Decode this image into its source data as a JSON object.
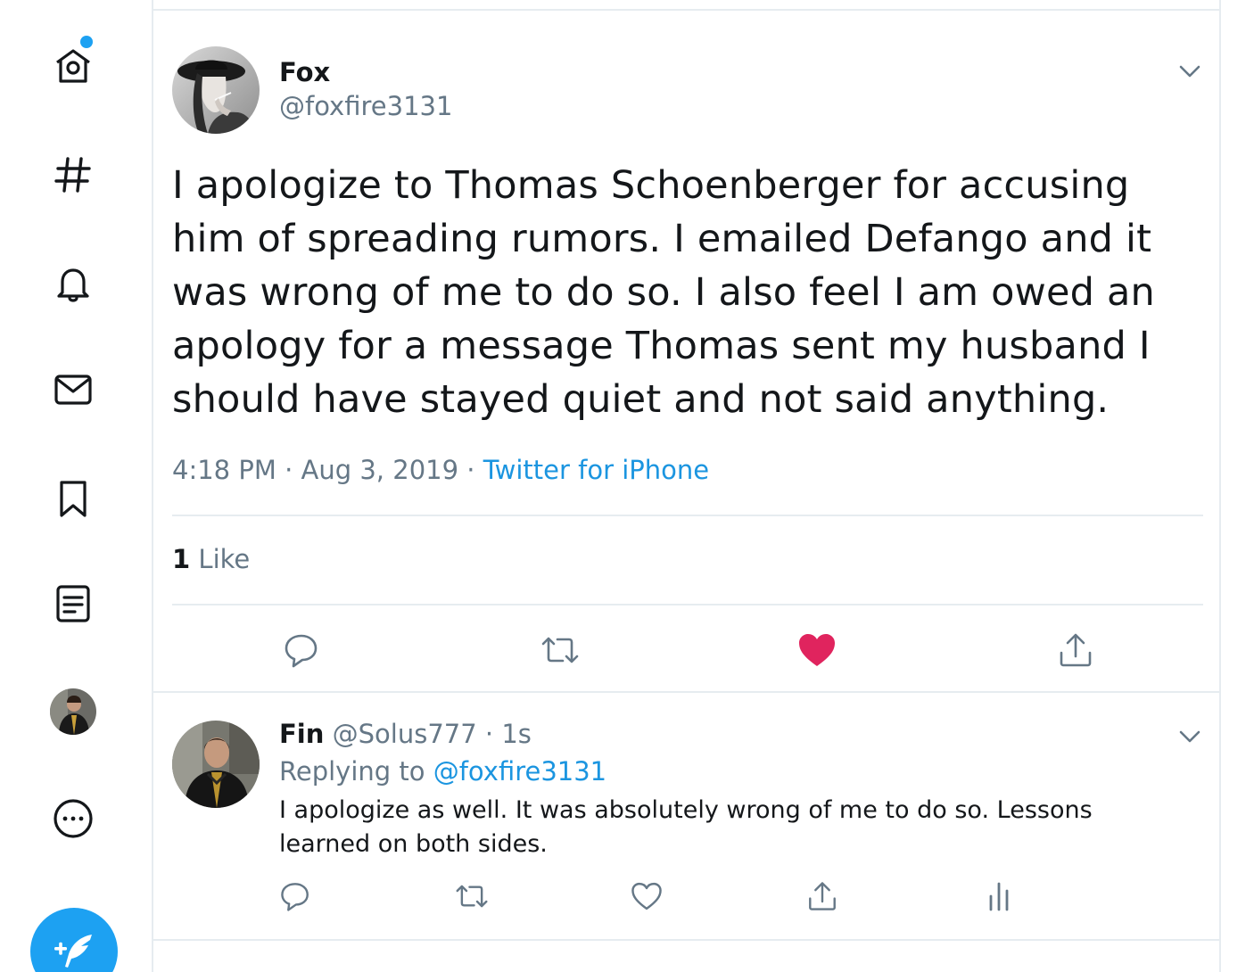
{
  "sidebar": {
    "icons": [
      "home-icon",
      "explore-hashtag-icon",
      "notifications-bell-icon",
      "messages-envelope-icon",
      "bookmarks-icon",
      "lists-icon",
      "more-icon",
      "compose-tweet-icon"
    ],
    "accent": "#1da1f2"
  },
  "tweet": {
    "display_name": "Fox",
    "handle": "@foxfire3131",
    "text": "I apologize to Thomas Schoenberger for accusing him of spreading rumors. I emailed Defango and it was wrong of me to do so. I also feel I am owed an apology for a message Thomas sent my husband I should have stayed quiet and not said anything.",
    "time": "4:18 PM",
    "date": "Aug 3, 2019",
    "separator": "·",
    "source": "Twitter for iPhone",
    "like_count": "1",
    "like_label": "Like",
    "liked": true,
    "like_color": "#e0245e"
  },
  "reply": {
    "display_name": "Fin",
    "handle": "@Solus777",
    "separator": "·",
    "time_ago": "1s",
    "replying_label": "Replying to",
    "replying_to": "@foxfire3131",
    "text": "I apologize as well. It was absolutely wrong of me to do so. Lessons learned on both sides."
  },
  "colors": {
    "text_primary": "#14171a",
    "text_secondary": "#657786",
    "link": "#1b95e0",
    "border": "#e6ecf0"
  }
}
